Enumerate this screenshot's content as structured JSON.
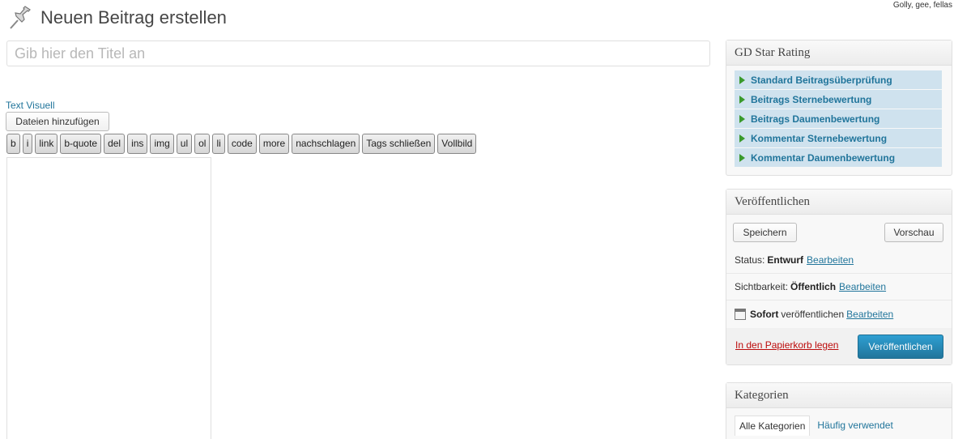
{
  "corner_note": "Golly, gee, fellas",
  "header": {
    "title": "Neuen Beitrag erstellen",
    "icon": "pushpin-icon"
  },
  "title_field": {
    "placeholder": "Gib hier den Titel an",
    "value": ""
  },
  "editor": {
    "mode_text": "Text",
    "mode_visual": "Visuell",
    "media_button": "Dateien hinzufügen",
    "quicktags": [
      "b",
      "i",
      "link",
      "b-quote",
      "del",
      "ins",
      "img",
      "ul",
      "ol",
      "li",
      "code",
      "more",
      "nachschlagen",
      "Tags schließen",
      "Vollbild"
    ]
  },
  "gd_star_rating": {
    "title": "GD Star Rating",
    "items": [
      "Standard Beitragsüberprüfung",
      "Beitrags Sternebewertung",
      "Beitrags Daumenbewertung",
      "Kommentar Sternebewertung",
      "Kommentar Daumenbewertung"
    ],
    "accent": "#cfe2ee"
  },
  "publish": {
    "title": "Veröffentlichen",
    "save_button": "Speichern",
    "preview_button": "Vorschau",
    "status_label": "Status:",
    "status_value": "Entwurf",
    "visibility_label": "Sichtbarkeit:",
    "visibility_value": "Öffentlich",
    "schedule_value": "Sofort",
    "schedule_label": "veröffentlichen",
    "edit_link": "Bearbeiten",
    "trash_link": "In den Papierkorb legen",
    "publish_button": "Veröffentlichen",
    "publish_color": "#21759b"
  },
  "categories": {
    "title": "Kategorien",
    "tab_all": "Alle Kategorien",
    "tab_popular": "Häufig verwendet"
  }
}
